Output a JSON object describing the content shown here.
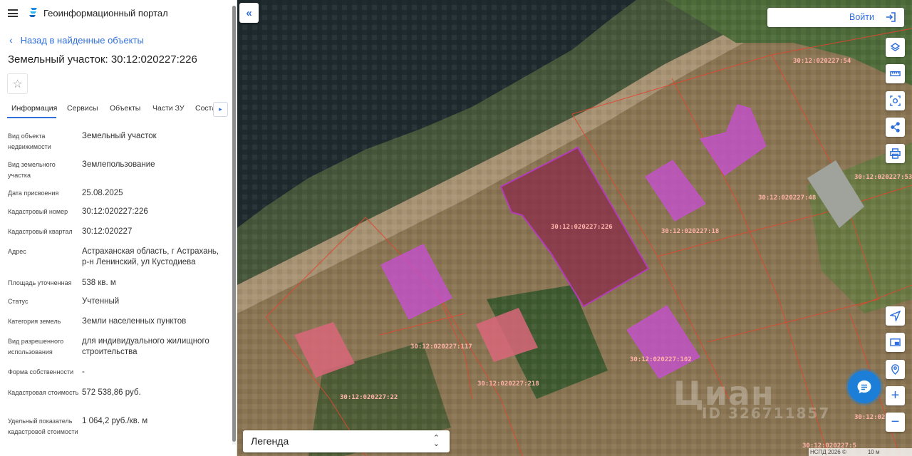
{
  "app": {
    "title": "Геоинформационный портал"
  },
  "sidebar": {
    "back_label": "Назад в найденные объекты",
    "object_title": "Земельный участок: 30:12:020227:226",
    "tabs": [
      {
        "label": "Информация"
      },
      {
        "label": "Сервисы"
      },
      {
        "label": "Объекты"
      },
      {
        "label": "Части ЗУ"
      },
      {
        "label": "Соста"
      }
    ],
    "attributes": [
      {
        "label": "Вид объекта недвижимости",
        "value": "Земельный участок"
      },
      {
        "label": "Вид земельного участка",
        "value": "Землепользование"
      },
      {
        "label": "Дата присвоения",
        "value": "25.08.2025"
      },
      {
        "label": "Кадастровый номер",
        "value": "30:12:020227:226"
      },
      {
        "label": "Кадастровый квартал",
        "value": "30:12:020227"
      },
      {
        "label": "Адрес",
        "value": "Астраханская область, г Астрахань, р-н Ленинский, ул Кустодиева"
      },
      {
        "label": "Площадь уточненная",
        "value": "538 кв. м"
      },
      {
        "label": "Статус",
        "value": "Учтенный"
      },
      {
        "label": "Категория земель",
        "value": "Земли населенных пунктов"
      },
      {
        "label": "Вид разрешенного использования",
        "value": "для индивидуального жилищного строительства"
      },
      {
        "label": "Форма собственности",
        "value": "-"
      },
      {
        "label": "Кадастровая стоимость",
        "value": "572 538,86 руб."
      },
      {
        "label": "Удельный показатель кадастровой стоимости",
        "value": "1 064,2 руб./кв. м"
      }
    ]
  },
  "map": {
    "login_label": "Войти",
    "legend_label": "Легенда",
    "attribution": "НСПД 2026 ©",
    "scale_label": "10 м",
    "watermark": "Циан",
    "watermark_id": "ID 326711857",
    "parcel_labels": [
      "30:12:020227:54",
      "30:12:020227:53",
      "30:12:020227:48",
      "30:12:020227:18",
      "30:12:020227:226",
      "30:12:020227:102",
      "30:12:020227:117",
      "30:12:020227:218",
      "30:12:020227:22",
      "30:12:020227:5",
      "30:12:020"
    ],
    "tools": [
      "layers-icon",
      "ruler-icon",
      "select-area-icon",
      "share-icon",
      "print-icon",
      "locate-icon",
      "minimap-icon",
      "geo-search-icon"
    ],
    "zoom_in": "+",
    "zoom_out": "−",
    "colors": {
      "selected_parcel": "#8a2a4a",
      "building": "#c64fd0",
      "boundary": "#e2452f",
      "accent": "#2f6fdc"
    }
  }
}
